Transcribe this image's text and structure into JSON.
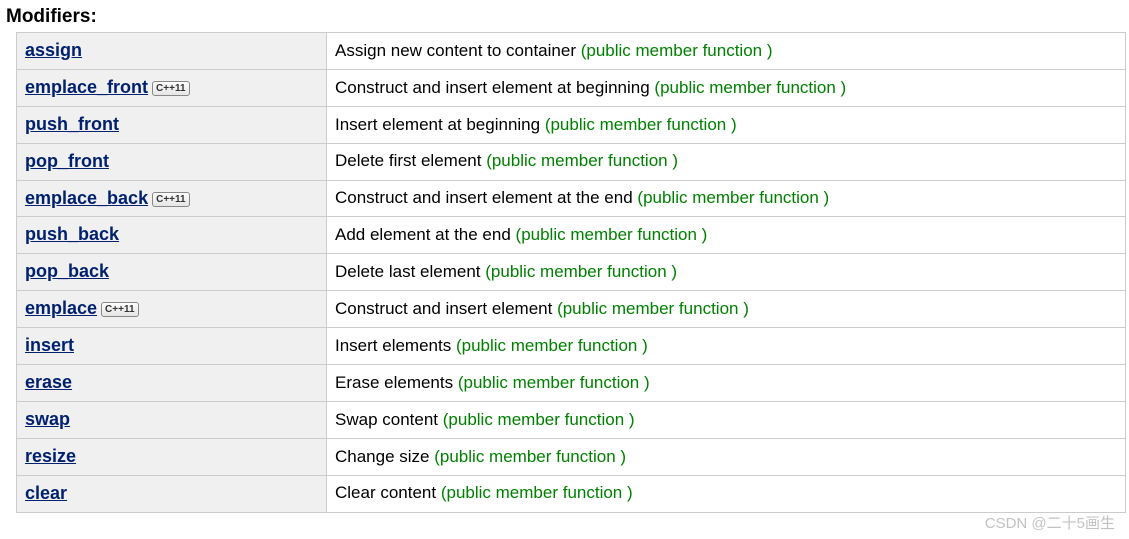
{
  "section_title": "Modifiers:",
  "annotation_text": "(public member function )",
  "cpp11_badge": "C++11",
  "watermark": "CSDN @二十5画生",
  "rows": [
    {
      "name": "assign",
      "cpp11": false,
      "desc": "Assign new content to container "
    },
    {
      "name": "emplace_front",
      "cpp11": true,
      "desc": "Construct and insert element at beginning "
    },
    {
      "name": "push_front",
      "cpp11": false,
      "desc": "Insert element at beginning "
    },
    {
      "name": "pop_front",
      "cpp11": false,
      "desc": "Delete first element "
    },
    {
      "name": "emplace_back",
      "cpp11": true,
      "desc": "Construct and insert element at the end "
    },
    {
      "name": "push_back",
      "cpp11": false,
      "desc": "Add element at the end "
    },
    {
      "name": "pop_back",
      "cpp11": false,
      "desc": "Delete last element "
    },
    {
      "name": "emplace",
      "cpp11": true,
      "desc": "Construct and insert element "
    },
    {
      "name": "insert",
      "cpp11": false,
      "desc": "Insert elements "
    },
    {
      "name": "erase",
      "cpp11": false,
      "desc": "Erase elements "
    },
    {
      "name": "swap",
      "cpp11": false,
      "desc": "Swap content "
    },
    {
      "name": "resize",
      "cpp11": false,
      "desc": "Change size "
    },
    {
      "name": "clear",
      "cpp11": false,
      "desc": "Clear content "
    }
  ]
}
